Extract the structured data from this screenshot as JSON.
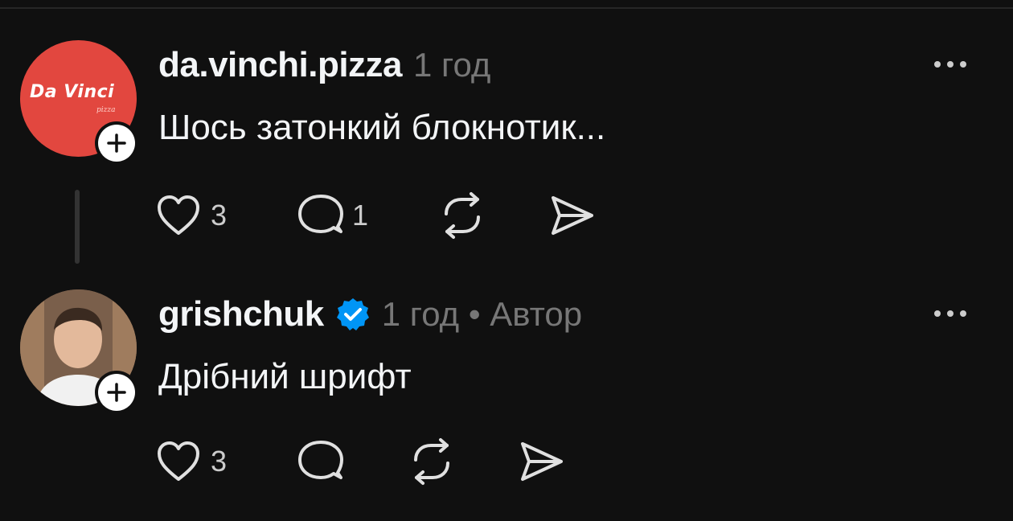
{
  "posts": [
    {
      "username": "da.vinchi.pizza",
      "time": "1 год",
      "text": "Шось затонкий блокнотик...",
      "avatar_logo_text": "Da Vinci",
      "avatar_logo_sub": "pizza",
      "likes": "3",
      "replies": "1",
      "verified": false
    },
    {
      "username": "grishchuk",
      "time": "1 год • Автор",
      "text": "Дрібний шрифт",
      "likes": "3",
      "verified": true
    }
  ],
  "colors": {
    "background": "#101010",
    "text": "#f3f5f7",
    "meta": "#777777",
    "verified": "#0095f6",
    "logo_bg": "#e2473f"
  },
  "icons": [
    "heart-icon",
    "comment-icon",
    "repost-icon",
    "share-icon",
    "more-icon",
    "plus-icon",
    "verified-badge-icon"
  ]
}
